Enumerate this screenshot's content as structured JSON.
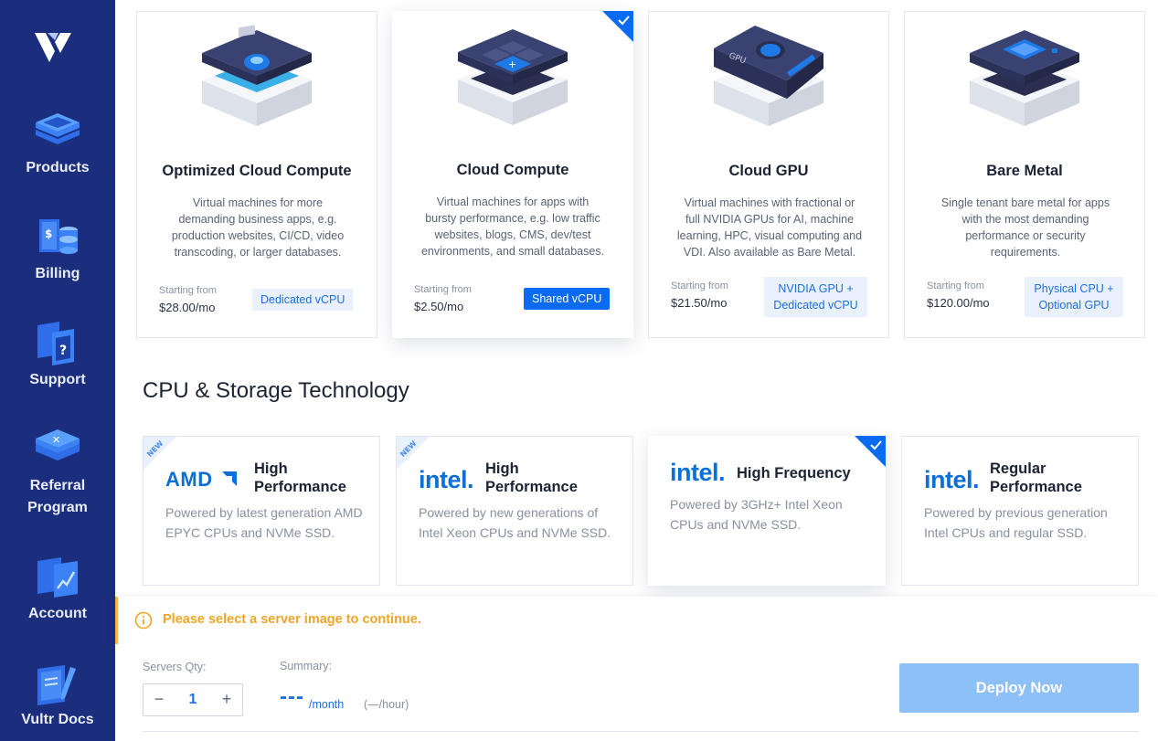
{
  "sidebar": {
    "items": [
      {
        "label": "Products",
        "icon": "products-icon"
      },
      {
        "label": "Billing",
        "icon": "billing-icon"
      },
      {
        "label": "Support",
        "icon": "support-icon"
      },
      {
        "label": "Referral Program",
        "label_line1": "Referral",
        "label_line2": "Program",
        "icon": "referral-icon"
      },
      {
        "label": "Account",
        "icon": "account-icon"
      },
      {
        "label": "Vultr Docs",
        "icon": "docs-icon"
      }
    ]
  },
  "server_types": [
    {
      "title": "Optimized Cloud Compute",
      "description": "Virtual machines for more demanding business apps, e.g. production websites, CI/CD, video transcoding, or larger databases.",
      "starting_label": "Starting from",
      "price": "$28.00/mo",
      "badge": "Dedicated vCPU",
      "selected": false
    },
    {
      "title": "Cloud Compute",
      "description": "Virtual machines for apps with bursty performance, e.g. low traffic websites, blogs, CMS, dev/test environments, and small databases.",
      "starting_label": "Starting from",
      "price": "$2.50/mo",
      "badge": "Shared vCPU",
      "selected": true
    },
    {
      "title": "Cloud GPU",
      "description": "Virtual machines with fractional or full NVIDIA GPUs for AI, machine learning, HPC, visual computing and VDI. Also available as Bare Metal.",
      "starting_label": "Starting from",
      "price": "$21.50/mo",
      "badge": "NVIDIA GPU + Dedicated vCPU",
      "badge_line1": "NVIDIA GPU +",
      "badge_line2": "Dedicated vCPU",
      "selected": false
    },
    {
      "title": "Bare Metal",
      "description": "Single tenant bare metal for apps with the most demanding performance or security requirements.",
      "starting_label": "Starting from",
      "price": "$120.00/mo",
      "badge": "Physical CPU + Optional GPU",
      "badge_line1": "Physical CPU +",
      "badge_line2": "Optional GPU",
      "selected": false
    }
  ],
  "tech_section": {
    "title": "CPU & Storage Technology",
    "items": [
      {
        "brand": "AMD",
        "name_line1": "High",
        "name_line2": "Performance",
        "description": "Powered by latest generation AMD EPYC CPUs and NVMe SSD.",
        "new_label": "NEW",
        "selected": false
      },
      {
        "brand": "intel.",
        "name_line1": "High",
        "name_line2": "Performance",
        "description": "Powered by new generations of Intel Xeon CPUs and NVMe SSD.",
        "new_label": "NEW",
        "selected": false
      },
      {
        "brand": "intel.",
        "name_line1": "High Frequency",
        "description": "Powered by 3GHz+ Intel Xeon CPUs and NVMe SSD.",
        "selected": true
      },
      {
        "brand": "intel.",
        "name_line1": "Regular",
        "name_line2": "Performance",
        "description": "Powered by previous generation Intel CPUs and regular SSD.",
        "selected": false
      }
    ]
  },
  "warning": {
    "text": "Please select a server image to continue."
  },
  "footer": {
    "qty_label": "Servers Qty:",
    "qty_value": "1",
    "minus": "−",
    "plus": "+",
    "summary_label": "Summary:",
    "price": "---",
    "per_month": "/month",
    "per_hour": "(—/hour)",
    "deploy_label": "Deploy Now"
  },
  "colors": {
    "sidebar": "#1b2e7d",
    "accent": "#0a6af2",
    "deploy_disabled": "#8dc0f6",
    "warning": "#f0a526"
  }
}
